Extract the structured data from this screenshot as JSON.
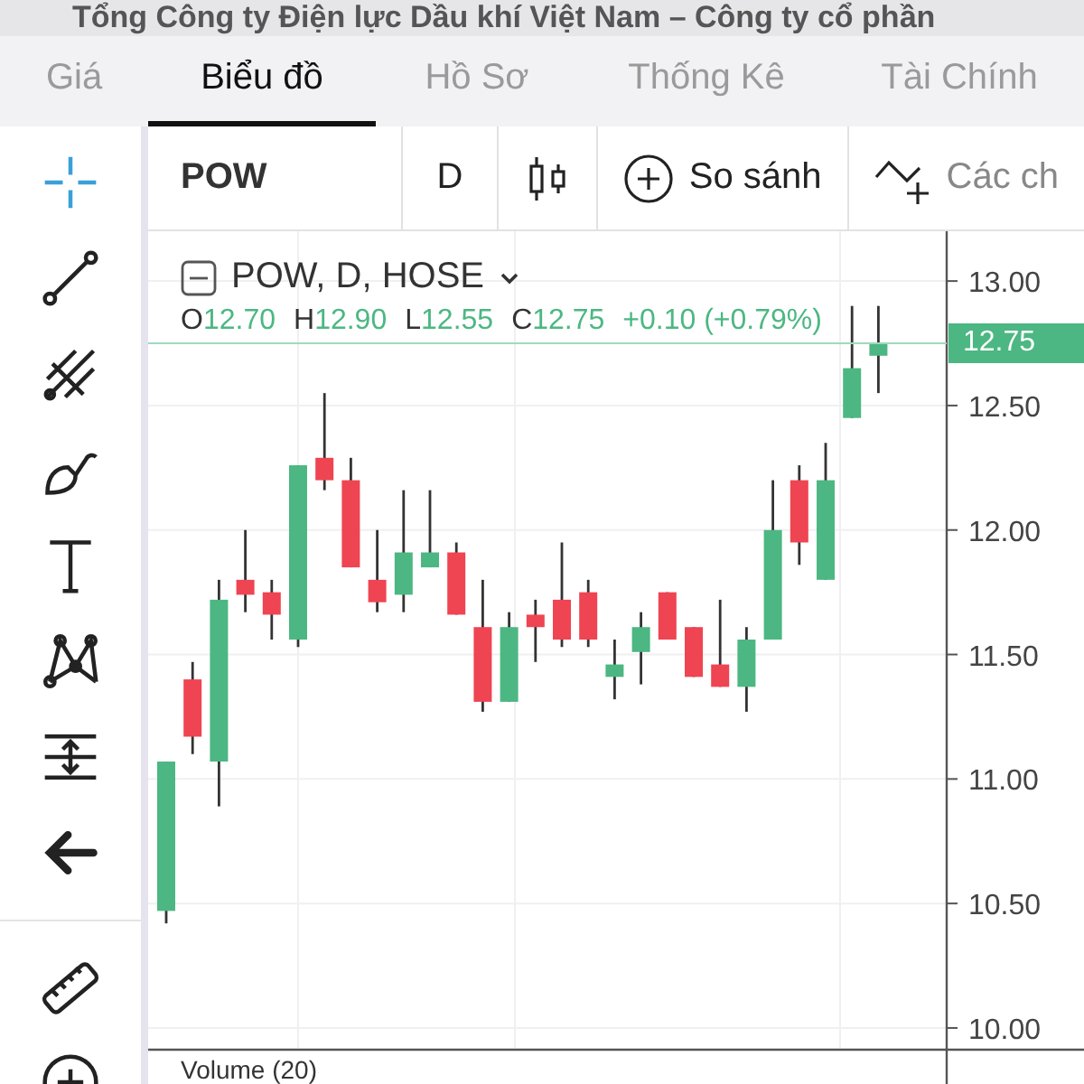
{
  "window": {
    "title": "Tổng Công ty Điện lực Dầu khí Việt Nam – Công ty cổ phần"
  },
  "tabs": [
    {
      "label": "Giá",
      "selected": false
    },
    {
      "label": "Biểu đồ",
      "selected": true
    },
    {
      "label": "Hồ Sơ",
      "selected": false
    },
    {
      "label": "Thống Kê",
      "selected": false
    },
    {
      "label": "Tài Chính",
      "selected": false
    }
  ],
  "drawing_tools": [
    {
      "kind": "crosshair",
      "selected": true
    },
    {
      "kind": "trend-line",
      "selected": false
    },
    {
      "kind": "pitchfork",
      "selected": false
    },
    {
      "kind": "brush",
      "selected": false
    },
    {
      "kind": "text",
      "selected": false
    },
    {
      "kind": "pattern",
      "selected": false
    },
    {
      "kind": "projection",
      "selected": false
    },
    {
      "kind": "collapse",
      "selected": false
    }
  ],
  "bottom_tools": [
    {
      "kind": "ruler"
    },
    {
      "kind": "zoom-in"
    }
  ],
  "toolbar": {
    "symbol": "POW",
    "interval": "D",
    "compare_label": "So sánh",
    "indicators_label": "Các ch"
  },
  "legend": {
    "title": "POW, D, HOSE",
    "values": [
      {
        "label": "O",
        "value": "12.70"
      },
      {
        "label": "H",
        "value": "12.90"
      },
      {
        "label": "L",
        "value": "12.55"
      },
      {
        "label": "C",
        "value": "12.75"
      }
    ],
    "change": "+0.10 (+0.79%)"
  },
  "last_price": "12.75",
  "chart_data": {
    "type": "candlestick",
    "ylim": [
      9.92,
      13.2
    ],
    "grid": true,
    "yticks": [
      {
        "value": 13,
        "label": "13.00"
      },
      {
        "value": 12.5,
        "label": "12.50"
      },
      {
        "value": 12,
        "label": "12.00"
      },
      {
        "value": 11.5,
        "label": "11.50"
      },
      {
        "value": 11,
        "label": "11.00"
      },
      {
        "value": 10.5,
        "label": "10.50"
      },
      {
        "value": 10,
        "label": "10.00"
      }
    ],
    "ohlc": [
      [
        10.47,
        11.07,
        10.42,
        11.07
      ],
      [
        11.4,
        11.47,
        11.1,
        11.17
      ],
      [
        11.07,
        11.8,
        10.89,
        11.72
      ],
      [
        11.8,
        12.0,
        11.67,
        11.74
      ],
      [
        11.75,
        11.8,
        11.56,
        11.66
      ],
      [
        11.56,
        12.26,
        11.53,
        12.26
      ],
      [
        12.29,
        12.55,
        12.16,
        12.2
      ],
      [
        12.2,
        12.29,
        11.85,
        11.85
      ],
      [
        11.8,
        12.0,
        11.67,
        11.71
      ],
      [
        11.74,
        12.16,
        11.67,
        11.91
      ],
      [
        11.85,
        12.16,
        11.85,
        11.91
      ],
      [
        11.91,
        11.95,
        11.66,
        11.66
      ],
      [
        11.61,
        11.8,
        11.27,
        11.31
      ],
      [
        11.31,
        11.67,
        11.31,
        11.61
      ],
      [
        11.66,
        11.72,
        11.47,
        11.61
      ],
      [
        11.72,
        11.95,
        11.53,
        11.56
      ],
      [
        11.75,
        11.8,
        11.53,
        11.56
      ],
      [
        11.41,
        11.56,
        11.32,
        11.46
      ],
      [
        11.51,
        11.67,
        11.38,
        11.61
      ],
      [
        11.75,
        11.75,
        11.56,
        11.56
      ],
      [
        11.61,
        11.61,
        11.41,
        11.41
      ],
      [
        11.46,
        11.72,
        11.37,
        11.37
      ],
      [
        11.37,
        11.61,
        11.27,
        11.56
      ],
      [
        11.56,
        12.2,
        11.56,
        12.0
      ],
      [
        12.2,
        12.26,
        11.86,
        11.95
      ],
      [
        11.8,
        12.35,
        11.8,
        12.2
      ],
      [
        12.45,
        12.9,
        12.45,
        12.65
      ],
      [
        12.7,
        12.9,
        12.55,
        12.75
      ]
    ]
  },
  "volume": {
    "label": "Volume (20)"
  }
}
